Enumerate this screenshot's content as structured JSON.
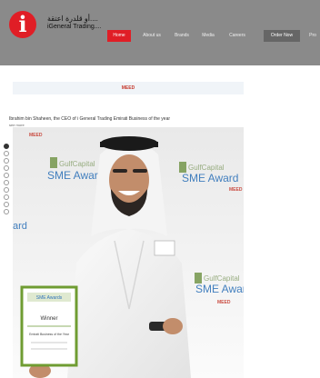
{
  "brand": {
    "ar": "أو قلدرة اعتقة....",
    "en": "iGeneral Trading...."
  },
  "nav": [
    {
      "label": "Home",
      "active": true
    },
    {
      "label": "About us"
    },
    {
      "label": "Brands"
    },
    {
      "label": "Media"
    },
    {
      "label": "Careers"
    },
    {
      "label": "Order Now",
      "emphasis": true
    },
    {
      "label": "Pro"
    }
  ],
  "banner": {
    "meed": "MEED"
  },
  "article": {
    "caption": "Ibrahim bin Shaheen, the CEO of i General Trading Emirati Business of the year",
    "subcaption": "see more",
    "watermark_meed": "MEED",
    "award_brand": "GulfCapital",
    "award_text": "SME Award",
    "award_text_partial": "SME Awar",
    "award_text_left": "ard",
    "award_meed": "MEED",
    "certificate_title": "Winner",
    "certificate_sub": "Emirati Business of the Year",
    "certificate_logo": "SME Awards"
  },
  "colors": {
    "brand_red": "#e01e26",
    "header_bg": "#8a8a8a",
    "order_bg": "#666666"
  }
}
